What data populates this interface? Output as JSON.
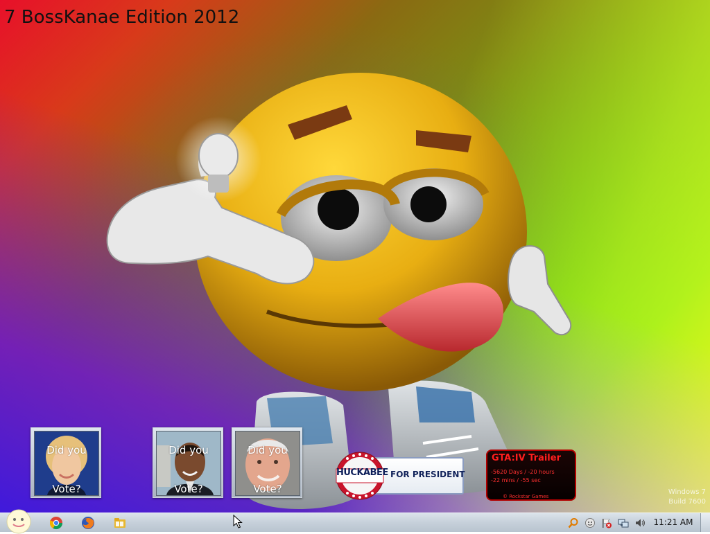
{
  "desktop": {
    "title": "7 BossKanae Edition 2012",
    "watermark": {
      "line1": "Windows 7",
      "line2": "Build 7600"
    }
  },
  "gadgets": {
    "vote_cards": [
      {
        "line1": "Did you",
        "line2": "Vote?"
      },
      {
        "line1": "Did you",
        "line2": "Vote?"
      },
      {
        "line1": "Did you",
        "line2": "Vote?"
      }
    ],
    "huckabee": {
      "name": "HUCKABEE",
      "tagline": "FOR PRESIDENT"
    },
    "gta": {
      "title": "GTA:IV  Trailer",
      "line1": "-5620 Days / -20 hours",
      "line2": "-22 mins / -55 sec",
      "credit": "©  Rockstar Games"
    }
  },
  "taskbar": {
    "pinned": [
      {
        "name": "chrome-icon"
      },
      {
        "name": "firefox-icon"
      },
      {
        "name": "folder-icon"
      }
    ],
    "tray": [
      {
        "name": "search-icon"
      },
      {
        "name": "messenger-icon"
      },
      {
        "name": "flag-icon"
      },
      {
        "name": "network-icon"
      },
      {
        "name": "volume-icon"
      }
    ],
    "clock": "11:21 AM"
  },
  "colors": {
    "taskbar": "#c6d0da",
    "gta_red": "#ff1e1e",
    "huckabee_blue": "#12235a"
  }
}
